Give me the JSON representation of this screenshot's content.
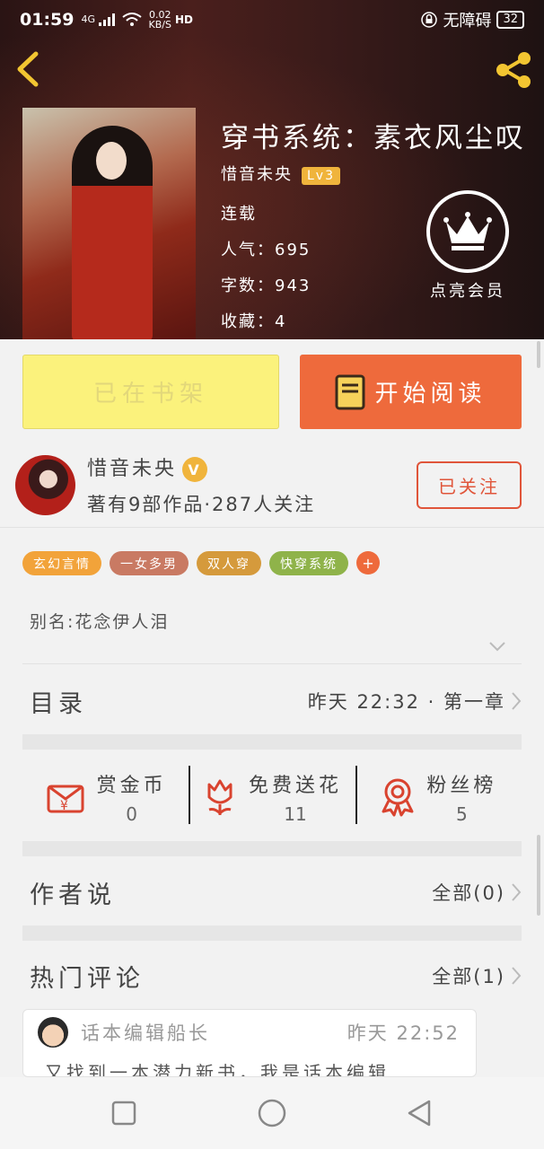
{
  "status_bar": {
    "time": "01:59",
    "network": "4G",
    "speed_value": "0.02",
    "speed_unit": "KB/S",
    "hd": "HD",
    "accessibility": "无障碍",
    "battery": "32"
  },
  "book": {
    "title": "穿书系统：素衣风尘叹",
    "author": "惜音未央",
    "level": "Lv3",
    "status": "连载",
    "popularity": "人气：695",
    "word_count": "字数：943",
    "favorites": "收藏：4"
  },
  "vip": {
    "label": "点亮会员"
  },
  "buttons": {
    "shelf": "已在书架",
    "read": "开始阅读"
  },
  "author_card": {
    "name": "惜音未央",
    "badge": "V",
    "stats": "著有9部作品·287人关注",
    "follow": "已关注"
  },
  "tags": [
    {
      "label": "玄幻言情",
      "color": "#f2a33a"
    },
    {
      "label": "一女多男",
      "color": "#c97a63"
    },
    {
      "label": "双人穿",
      "color": "#d59a3c"
    },
    {
      "label": "快穿系统",
      "color": "#8fb34a"
    }
  ],
  "tag_more": "+",
  "alias": "别名:花念伊人泪",
  "catalog": {
    "title": "目录",
    "updated": "昨天 22:32 · 第一章"
  },
  "stats": [
    {
      "label": "赏金币",
      "value": "0"
    },
    {
      "label": "免费送花",
      "value": "11"
    },
    {
      "label": "粉丝榜",
      "value": "5"
    }
  ],
  "author_says": {
    "title": "作者说",
    "link": "全部(0)"
  },
  "hot_comments": {
    "title": "热门评论",
    "link": "全部(1)"
  },
  "comment": {
    "user": "话本编辑船长",
    "time": "昨天 22:52",
    "text": "又找到一本潜力新书，我是话本编辑"
  },
  "colors": {
    "accent": "#ee6a3c",
    "shelf_bg": "#fbf27c",
    "follow": "#e0553a"
  }
}
